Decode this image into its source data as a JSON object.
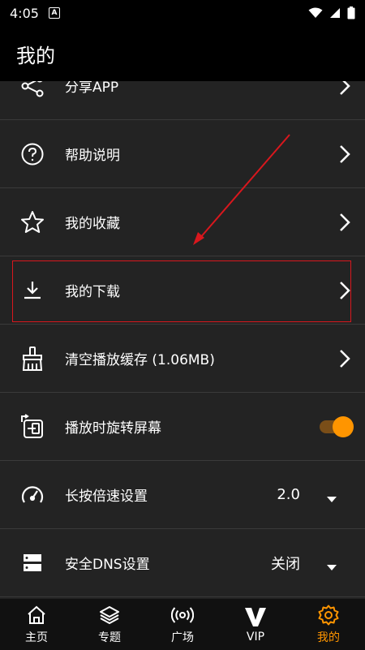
{
  "status_bar": {
    "time": "4:05",
    "notification_letter": "A"
  },
  "header": {
    "title": "我的"
  },
  "menu": {
    "share": "分享APP",
    "help": "帮助说明",
    "favorites": "我的收藏",
    "downloads": "我的下载",
    "clear_cache": "清空播放缓存 (1.06MB)",
    "rotate": "播放时旋转屏幕",
    "rotate_on": true,
    "speed": "长按倍速设置",
    "speed_value": "2.0",
    "dns": "安全DNS设置",
    "dns_value": "关闭"
  },
  "tabs": [
    {
      "label": "主页",
      "icon": "home-icon"
    },
    {
      "label": "专题",
      "icon": "layers-icon"
    },
    {
      "label": "广场",
      "icon": "broadcast-icon"
    },
    {
      "label": "VIP",
      "icon": "vip-icon"
    },
    {
      "label": "我的",
      "icon": "gear-icon"
    }
  ],
  "colors": {
    "accent": "#ff9500",
    "highlight": "#d9171d",
    "background": "#232323"
  }
}
